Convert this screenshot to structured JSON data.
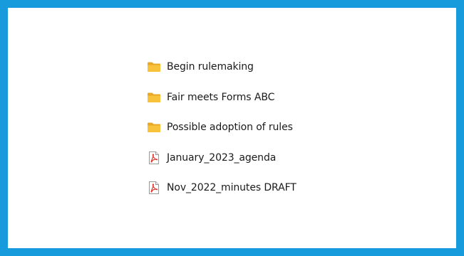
{
  "colors": {
    "frame_border": "#179bdc",
    "folder": "#f8c33a",
    "pdf_accent": "#d9352a"
  },
  "files": [
    {
      "name": "Begin rulemaking",
      "type": "folder",
      "icon": "folder-icon"
    },
    {
      "name": "Fair meets Forms ABC",
      "type": "folder",
      "icon": "folder-icon"
    },
    {
      "name": "Possible adoption of rules",
      "type": "folder",
      "icon": "folder-icon"
    },
    {
      "name": "January_2023_agenda",
      "type": "pdf",
      "icon": "pdf-file-icon"
    },
    {
      "name": "Nov_2022_minutes DRAFT",
      "type": "pdf",
      "icon": "pdf-file-icon"
    }
  ]
}
